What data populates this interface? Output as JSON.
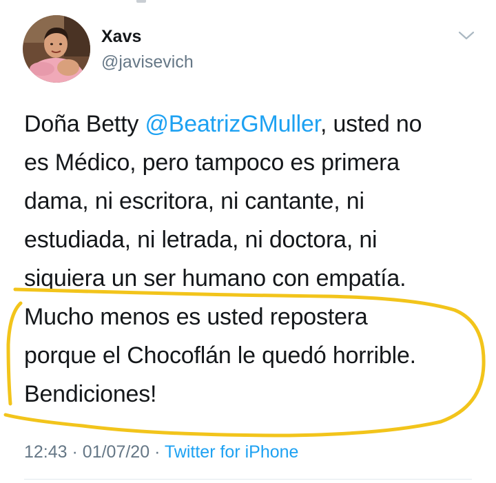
{
  "tweet": {
    "author": {
      "display_name": "Xavs",
      "handle": "@javisevich",
      "avatar_icon": "profile-photo"
    },
    "menu_icon": "chevron-down-icon",
    "text_lines": [
      {
        "before": "Doña Betty ",
        "mention": "@BeatrizGMuller",
        "after": ", usted no"
      },
      {
        "text": "es Médico, pero tampoco es primera"
      },
      {
        "text": "dama, ni escritora, ni cantante, ni"
      },
      {
        "text": "estudiada, ni letrada, ni doctora, ni"
      },
      {
        "text": "siquiera un ser humano con empatía."
      },
      {
        "text": "Mucho menos es usted repostera"
      },
      {
        "text": "porque el Chocoflán le quedó horrible."
      },
      {
        "text": "Bendiciones!"
      }
    ],
    "time": "12:43",
    "date": "01/07/20",
    "separator": "·",
    "source": "Twitter for iPhone"
  },
  "annotation": {
    "color": "#f2c41b",
    "shape": "hand-drawn-loop"
  }
}
